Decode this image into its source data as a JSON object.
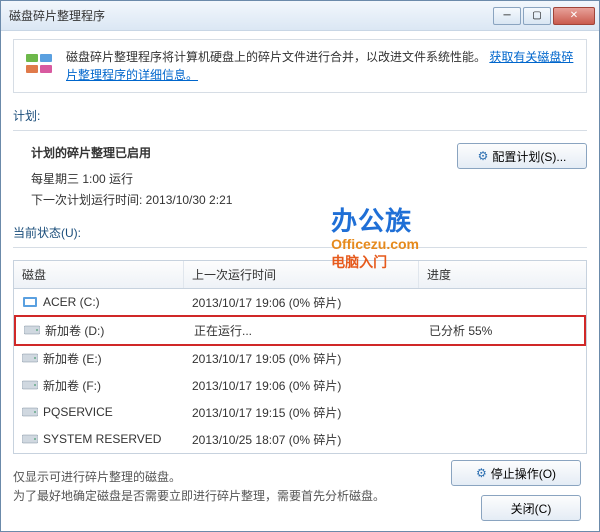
{
  "titlebar": {
    "title": "磁盘碎片整理程序"
  },
  "info": {
    "text": "磁盘碎片整理程序将计算机硬盘上的碎片文件进行合并，以改进文件系统性能。",
    "link": "获取有关磁盘碎片整理程序的详细信息。"
  },
  "schedule": {
    "section_label": "计划:",
    "heading": "计划的碎片整理已启用",
    "line1": "每星期三  1:00 运行",
    "line2": "下一次计划运行时间: 2013/10/30 2:21",
    "config_btn": "配置计划(S)..."
  },
  "status": {
    "section_label": "当前状态(U):",
    "headers": {
      "disk": "磁盘",
      "last": "上一次运行时间",
      "progress": "进度"
    },
    "rows": [
      {
        "name": "ACER (C:)",
        "last": "2013/10/17 19:06 (0% 碎片)",
        "progress": "",
        "icon": "acer"
      },
      {
        "name": "新加卷 (D:)",
        "last": "正在运行...",
        "progress": "已分析 55%",
        "icon": "drive",
        "highlight": true
      },
      {
        "name": "新加卷 (E:)",
        "last": "2013/10/17 19:05 (0% 碎片)",
        "progress": "",
        "icon": "drive"
      },
      {
        "name": "新加卷 (F:)",
        "last": "2013/10/17 19:06 (0% 碎片)",
        "progress": "",
        "icon": "drive"
      },
      {
        "name": "PQSERVICE",
        "last": "2013/10/17 19:15 (0% 碎片)",
        "progress": "",
        "icon": "drive"
      },
      {
        "name": "SYSTEM RESERVED",
        "last": "2013/10/25 18:07 (0% 碎片)",
        "progress": "",
        "icon": "drive"
      }
    ]
  },
  "note": {
    "line1": "仅显示可进行碎片整理的磁盘。",
    "line2": "为了最好地确定磁盘是否需要立即进行碎片整理，需要首先分析磁盘。"
  },
  "buttons": {
    "stop": "停止操作(O)",
    "close": "关闭(C)"
  },
  "watermark": {
    "l1": "办公族",
    "l2": "Officezu.com",
    "l3": "电脑入门"
  }
}
